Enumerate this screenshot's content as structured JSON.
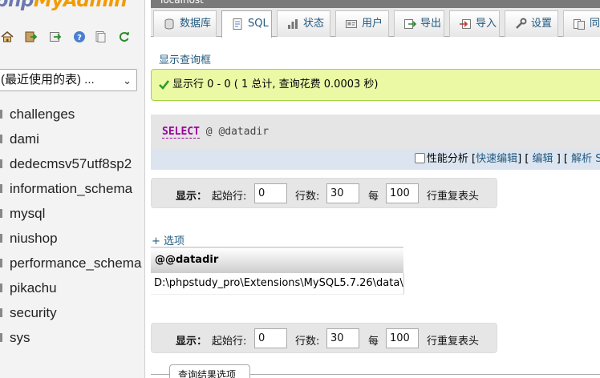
{
  "logo": {
    "php": "php",
    "admin": "MyAdmin"
  },
  "nav_icons": [
    "home-icon",
    "exit-icon",
    "next-icon",
    "help-icon",
    "docs-icon",
    "reload-icon"
  ],
  "recent_tables": {
    "label": "(最近使用的表) ...",
    "caret": "⌄"
  },
  "databases": [
    "challenges",
    "dami",
    "dedecmsv57utf8sp2",
    "information_schema",
    "mysql",
    "niushop",
    "performance_schema",
    "pikachu",
    "security",
    "sys"
  ],
  "server": {
    "title": "localhost"
  },
  "tabs": [
    {
      "label": "数据库",
      "icon": "database-icon"
    },
    {
      "label": "SQL",
      "icon": "sql-icon"
    },
    {
      "label": "状态",
      "icon": "status-icon"
    },
    {
      "label": "用户",
      "icon": "users-icon"
    },
    {
      "label": "导出",
      "icon": "export-icon"
    },
    {
      "label": "导入",
      "icon": "import-icon"
    },
    {
      "label": "设置",
      "icon": "settings-icon"
    },
    {
      "label": "同步",
      "icon": "sync-icon"
    }
  ],
  "show_query_box": "显示查询框",
  "success_message": "显示行 0 - 0 ( 1 总计, 查询花费 0.0003 秒)",
  "sql": {
    "keyword": "SELECT",
    "rest": " @ @datadir"
  },
  "tools": {
    "profiling_label": "性能分析",
    "open_bracket": "[",
    "inline_edit": "快速编辑",
    "close_bracket": "]",
    "edit": "编辑",
    "explain": "解析 SQL"
  },
  "pagination": {
    "show_label": "显示：",
    "start_label": "起始行:",
    "start_value": "0",
    "rows_label": "行数:",
    "rows_value": "30",
    "every_label": "每",
    "every_value": "100",
    "repeat_label": "行重复表头"
  },
  "options_link": "+ 选项",
  "result_table": {
    "column": "@@datadir",
    "rows": [
      "D:\\phpstudy_pro\\Extensions\\MySQL5.7.26\\data\\"
    ]
  },
  "query_results_options": "查询结果选项",
  "colors": {
    "link": "#235a81",
    "success_bg": "#ebf8a4",
    "success_border": "#a2d246",
    "sql_keyword": "#990099",
    "logo_php": "#6c78b0",
    "logo_admin": "#f29b00"
  }
}
